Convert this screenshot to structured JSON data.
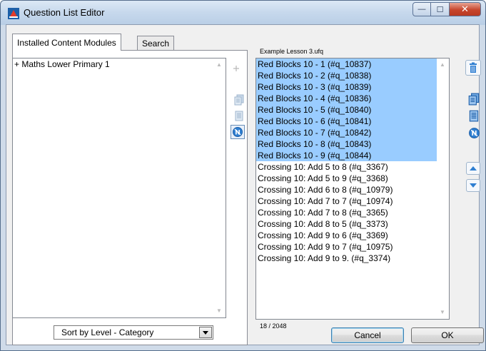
{
  "window": {
    "title": "Question List Editor",
    "minimize_glyph": "—",
    "maximize_glyph": "☐",
    "close_glyph": "✕"
  },
  "tabs": [
    {
      "label": "Installed Content Modules",
      "active": true
    },
    {
      "label": "Search",
      "active": false
    }
  ],
  "left_list": {
    "items": [
      "+ Maths Lower Primary 1"
    ]
  },
  "sort_combo": {
    "selected": "Sort by Level - Category"
  },
  "right_list": {
    "file_label": "Example Lesson 3.ufq",
    "items": [
      {
        "label": "Red Blocks 10 - 1 (#q_10837)",
        "selected": true
      },
      {
        "label": "Red Blocks 10 - 2 (#q_10838)",
        "selected": true
      },
      {
        "label": "Red Blocks 10 - 3 (#q_10839)",
        "selected": true
      },
      {
        "label": "Red Blocks 10 - 4 (#q_10836)",
        "selected": true
      },
      {
        "label": "Red Blocks 10 - 5 (#q_10840)",
        "selected": true
      },
      {
        "label": "Red Blocks 10 - 6 (#q_10841)",
        "selected": true
      },
      {
        "label": "Red Blocks 10 - 7 (#q_10842)",
        "selected": true
      },
      {
        "label": "Red Blocks 10 - 8 (#q_10843)",
        "selected": true
      },
      {
        "label": "Red Blocks 10 - 9 (#q_10844)",
        "selected": true
      },
      {
        "label": "Crossing 10: Add 5 to 8 (#q_3367)",
        "selected": false
      },
      {
        "label": "Crossing 10: Add 5 to 9 (#q_3368)",
        "selected": false
      },
      {
        "label": "Crossing 10: Add 6 to 8 (#q_10979)",
        "selected": false
      },
      {
        "label": "Crossing 10: Add 7 to 7 (#q_10974)",
        "selected": false
      },
      {
        "label": "Crossing 10: Add 7 to 8 (#q_3365)",
        "selected": false
      },
      {
        "label": "Crossing 10: Add 8 to 5 (#q_3373)",
        "selected": false
      },
      {
        "label": "Crossing 10: Add 9 to 6 (#q_3369)",
        "selected": false
      },
      {
        "label": "Crossing 10: Add 9 to 7 (#q_10975)",
        "selected": false
      },
      {
        "label": "Crossing 10: Add 9 to 9. (#q_3374)",
        "selected": false
      }
    ],
    "count_label": "18 / 2048"
  },
  "buttons": {
    "cancel": "Cancel",
    "ok": "OK"
  },
  "icons": {
    "left_column": [
      "add-icon",
      "copy-icon",
      "copy-all-icon",
      "clear-icon"
    ],
    "right_column": [
      "trash-icon",
      "copy-icon",
      "copy-all-icon",
      "clear-icon",
      "move-up-icon",
      "move-down-icon"
    ]
  },
  "colors": {
    "selection": "#99ccff",
    "icon_blue": "#2f7fd1"
  }
}
